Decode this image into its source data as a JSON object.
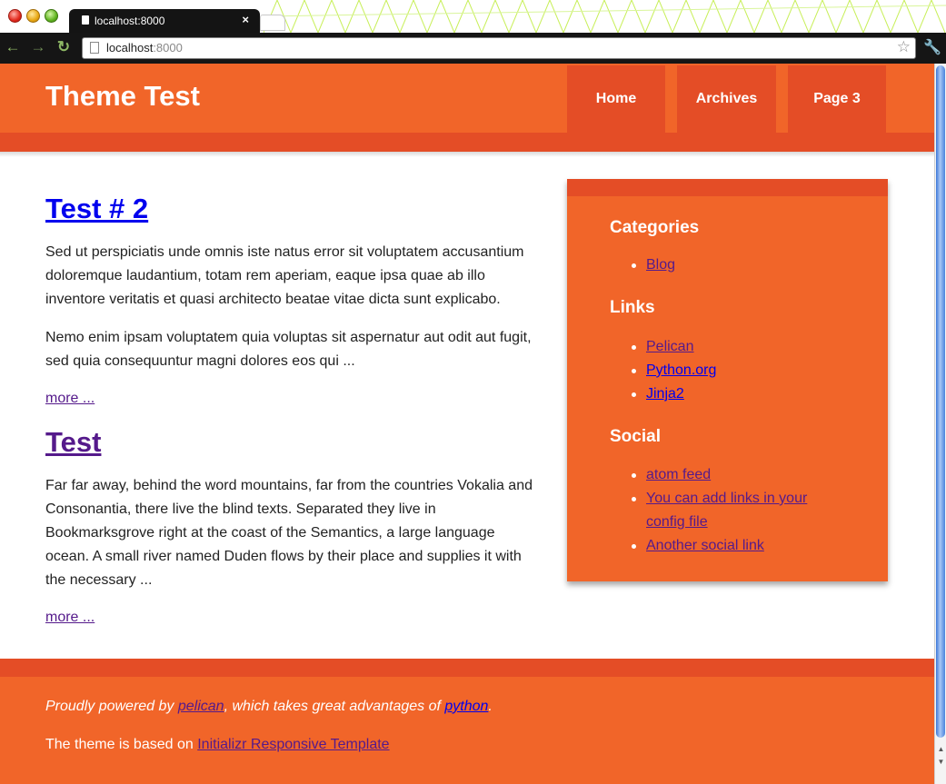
{
  "browser": {
    "tab_title": "localhost:8000",
    "tab_close": "×",
    "url_host": "localhost",
    "url_port": ":8000",
    "bookmark_star": "☆",
    "back_glyph": "←",
    "forward_glyph": "→",
    "reload_glyph": "↻",
    "wrench_glyph": "🔧"
  },
  "site": {
    "title": "Theme Test",
    "nav": [
      "Home",
      "Archives",
      "Page 3"
    ]
  },
  "articles": [
    {
      "title": "Test # 2",
      "paragraphs": [
        "Sed ut perspiciatis unde omnis iste natus error sit voluptatem accusantium doloremque laudantium, totam rem aperiam, eaque ipsa quae ab illo inventore veritatis et quasi architecto beatae vitae dicta sunt explicabo.",
        "Nemo enim ipsam voluptatem quia voluptas sit aspernatur aut odit aut fugit, sed quia consequuntur magni dolores eos qui ..."
      ],
      "more": "more ..."
    },
    {
      "title": "Test",
      "paragraphs": [
        "Far far away, behind the word mountains, far from the countries Vokalia and Consonantia, there live the blind texts. Separated they live in Bookmarksgrove right at the coast of the Semantics, a large language ocean. A small river named Duden flows by their place and supplies it with the necessary ..."
      ],
      "more": "more ..."
    }
  ],
  "sidebar": {
    "categories_heading": "Categories",
    "categories": [
      "Blog"
    ],
    "links_heading": "Links",
    "links": [
      "Pelican",
      "Python.org",
      "Jinja2"
    ],
    "social_heading": "Social",
    "social": [
      "atom feed",
      "You can add links in your config file",
      "Another social link"
    ]
  },
  "footer": {
    "powered_prefix": "Proudly powered by ",
    "pelican_link": "pelican",
    "powered_middle": ", which takes great advantages of ",
    "python_link": "python",
    "powered_suffix": ".",
    "theme_prefix": "The theme is based on ",
    "theme_link": "Initializr Responsive Template"
  },
  "colors": {
    "brand_orange": "#f16529",
    "brand_dark_orange": "#e44d26",
    "link_blue": "#0000ee",
    "link_visited": "#551a8b"
  }
}
